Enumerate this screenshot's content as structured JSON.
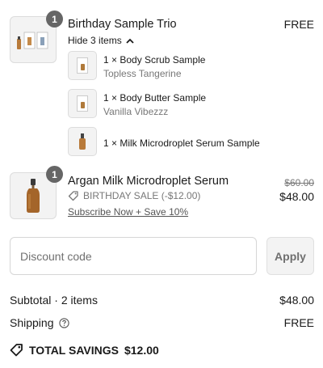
{
  "line_items": [
    {
      "quantity": "1",
      "title": "Birthday Sample Trio",
      "price": "FREE",
      "toggle_label": "Hide 3 items",
      "components": [
        {
          "name": "1 × Body Scrub Sample",
          "variant": "Topless Tangerine"
        },
        {
          "name": "1 × Body Butter Sample",
          "variant": "Vanilla Vibezzz"
        },
        {
          "name": "1 × Milk Microdroplet Serum Sample",
          "variant": ""
        }
      ]
    },
    {
      "quantity": "1",
      "title": "Argan Milk Microdroplet Serum",
      "original_price": "$60.00",
      "price": "$48.00",
      "discount_label": "BIRTHDAY SALE (-$12.00)",
      "subscribe_link": "Subscribe Now + Save 10%"
    }
  ],
  "discount": {
    "placeholder": "Discount code",
    "apply_label": "Apply"
  },
  "summary": {
    "subtotal_label": "Subtotal · 2 items",
    "subtotal_value": "$48.00",
    "shipping_label": "Shipping",
    "shipping_value": "FREE",
    "savings_label": "TOTAL SAVINGS",
    "savings_value": "$12.00"
  },
  "colors": {
    "badge": "#666666",
    "border": "#dcdcdc",
    "muted_text": "#777777",
    "bottle": "#a4652a"
  }
}
